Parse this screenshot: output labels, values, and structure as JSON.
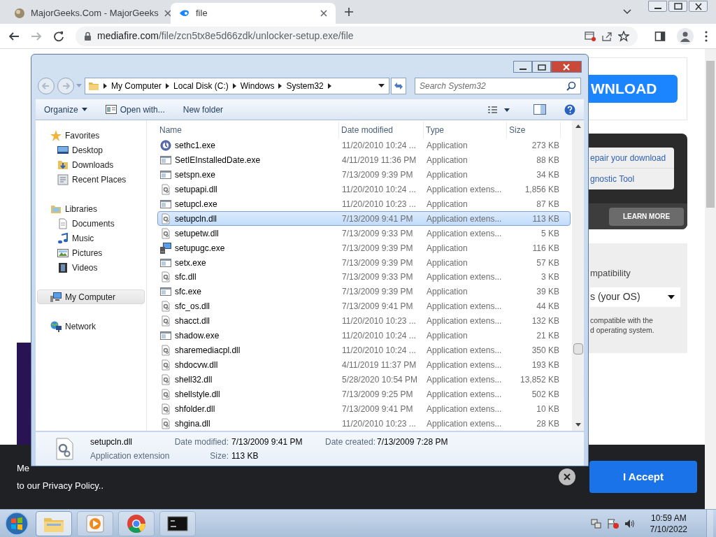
{
  "browser": {
    "tabs": [
      {
        "title": "MajorGeeks.Com - MajorGeeks",
        "kind": "majorgeeks",
        "selected": false
      },
      {
        "title": "file",
        "kind": "mediafire",
        "selected": true
      }
    ],
    "url_host": "mediafire.com",
    "url_path": "/file/zcn5tx8e5d66zdk/unlocker-setup.exe/file"
  },
  "page": {
    "download_button": "WNLOAD",
    "repair_links": [
      "epair your download",
      "gnostic Tool"
    ],
    "learn_more": "LEARN MORE",
    "compatibility_label": "mpatibility",
    "os_select": "s (your OS)",
    "compat_note": [
      "compatible with the",
      "d operating system."
    ]
  },
  "cookie_banner": {
    "text_start": "Me",
    "text_end": "to our Privacy Policy..",
    "accept": "I Accept"
  },
  "explorer": {
    "breadcrumb": [
      "My Computer",
      "Local Disk (C:)",
      "Windows",
      "System32"
    ],
    "search": {
      "placeholder": "Search System32"
    },
    "toolbar": [
      {
        "label": "Organize",
        "kind": "menu"
      },
      {
        "label": "Open with...",
        "kind": "icon"
      },
      {
        "label": "New folder",
        "kind": "plain"
      }
    ],
    "nav": [
      {
        "label": "Favorites",
        "kind": "star",
        "selected": false,
        "children": [
          {
            "label": "Desktop",
            "kind": "desktop"
          },
          {
            "label": "Downloads",
            "kind": "downloads"
          },
          {
            "label": "Recent Places",
            "kind": "recent"
          }
        ]
      },
      {
        "label": "Libraries",
        "kind": "library",
        "selected": false,
        "children": [
          {
            "label": "Documents",
            "kind": "document"
          },
          {
            "label": "Music",
            "kind": "music"
          },
          {
            "label": "Pictures",
            "kind": "pictures"
          },
          {
            "label": "Videos",
            "kind": "videos"
          }
        ]
      },
      {
        "label": "My Computer",
        "kind": "computer",
        "selected": true
      },
      {
        "label": "Network",
        "kind": "network",
        "selected": false
      }
    ],
    "columns": [
      "Name",
      "Date modified",
      "Type",
      "Size"
    ],
    "rows": [
      {
        "name": "sethc1.exe",
        "date": "11/20/2010 10:24 ...",
        "type": "Application",
        "size": "273 KB",
        "kind": "round",
        "selected": false
      },
      {
        "name": "SetIEInstalledDate.exe",
        "date": "4/11/2019 11:36 PM",
        "type": "Application",
        "size": "88 KB",
        "kind": "exe",
        "selected": false
      },
      {
        "name": "setspn.exe",
        "date": "7/13/2009 9:39 PM",
        "type": "Application",
        "size": "34 KB",
        "kind": "exe",
        "selected": false
      },
      {
        "name": "setupapi.dll",
        "date": "11/20/2010 10:24 ...",
        "type": "Application extens...",
        "size": "1,856 KB",
        "kind": "dll",
        "selected": false
      },
      {
        "name": "setupcl.exe",
        "date": "11/20/2010 10:23 ...",
        "type": "Application",
        "size": "87 KB",
        "kind": "exe",
        "selected": false
      },
      {
        "name": "setupcln.dll",
        "date": "7/13/2009 9:41 PM",
        "type": "Application extens...",
        "size": "113 KB",
        "kind": "dll",
        "selected": true
      },
      {
        "name": "setupetw.dll",
        "date": "7/13/2009 9:33 PM",
        "type": "Application extens...",
        "size": "5 KB",
        "kind": "dll",
        "selected": false
      },
      {
        "name": "setupugc.exe",
        "date": "7/13/2009 9:39 PM",
        "type": "Application",
        "size": "116 KB",
        "kind": "setup",
        "selected": false
      },
      {
        "name": "setx.exe",
        "date": "7/13/2009 9:39 PM",
        "type": "Application",
        "size": "57 KB",
        "kind": "exe",
        "selected": false
      },
      {
        "name": "sfc.dll",
        "date": "7/13/2009 9:33 PM",
        "type": "Application extens...",
        "size": "3 KB",
        "kind": "dll",
        "selected": false
      },
      {
        "name": "sfc.exe",
        "date": "7/13/2009 9:39 PM",
        "type": "Application",
        "size": "39 KB",
        "kind": "exe",
        "selected": false
      },
      {
        "name": "sfc_os.dll",
        "date": "7/13/2009 9:41 PM",
        "type": "Application extens...",
        "size": "44 KB",
        "kind": "dll",
        "selected": false
      },
      {
        "name": "shacct.dll",
        "date": "11/20/2010 10:23 ...",
        "type": "Application extens...",
        "size": "132 KB",
        "kind": "dll",
        "selected": false
      },
      {
        "name": "shadow.exe",
        "date": "11/20/2010 10:24 ...",
        "type": "Application",
        "size": "21 KB",
        "kind": "exe",
        "selected": false
      },
      {
        "name": "sharemediacpl.dll",
        "date": "11/20/2010 10:24 ...",
        "type": "Application extens...",
        "size": "350 KB",
        "kind": "dll",
        "selected": false
      },
      {
        "name": "shdocvw.dll",
        "date": "4/11/2019 11:37 PM",
        "type": "Application extens...",
        "size": "193 KB",
        "kind": "dll",
        "selected": false
      },
      {
        "name": "shell32.dll",
        "date": "5/28/2020 10:54 PM",
        "type": "Application extens...",
        "size": "13,852 KB",
        "kind": "dll",
        "selected": false
      },
      {
        "name": "shellstyle.dll",
        "date": "7/13/2009 9:25 PM",
        "type": "Application extens...",
        "size": "502 KB",
        "kind": "dll",
        "selected": false
      },
      {
        "name": "shfolder.dll",
        "date": "7/13/2009 9:41 PM",
        "type": "Application extens...",
        "size": "10 KB",
        "kind": "dll",
        "selected": false
      },
      {
        "name": "shgina.dll",
        "date": "11/20/2010 10:23 ...",
        "type": "Application extens...",
        "size": "28 KB",
        "kind": "dll",
        "selected": false
      }
    ],
    "details": {
      "name": "setupcln.dll",
      "type": "Application extension",
      "fields": [
        {
          "label": "Date modified:",
          "value": "7/13/2009 9:41 PM"
        },
        {
          "label": "Date created:",
          "value": "7/13/2009 7:28 PM"
        },
        {
          "label": "Size:",
          "value": "113 KB"
        }
      ]
    }
  },
  "taskbar": {
    "items": [
      {
        "kind": "folder",
        "selected": true
      },
      {
        "kind": "media",
        "selected": false
      },
      {
        "kind": "chrome",
        "selected": false
      },
      {
        "kind": "console",
        "selected": false
      }
    ],
    "time": "10:59 AM",
    "date": "7/10/2022"
  }
}
